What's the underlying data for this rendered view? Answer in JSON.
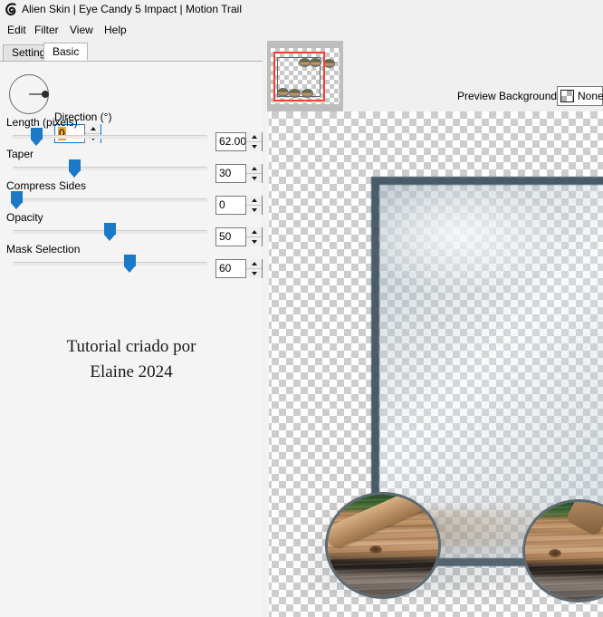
{
  "window": {
    "icon": "alien-skin-logo-icon",
    "title": "Alien Skin | Eye Candy 5 Impact | Motion Trail"
  },
  "menubar": {
    "items": [
      {
        "label": "Edit"
      },
      {
        "label": "Filter"
      },
      {
        "label": "View"
      },
      {
        "label": "Help"
      }
    ]
  },
  "tabs": [
    {
      "label": "Settings",
      "active": false
    },
    {
      "label": "Basic",
      "active": true
    }
  ],
  "controls": {
    "direction": {
      "label": "Direction (°)",
      "value": "0",
      "selected": true,
      "dial_angle_deg": 0
    },
    "sliders": [
      {
        "label": "Length (pixels)",
        "value": "62.00",
        "thumb_pct": 12
      },
      {
        "label": "Taper",
        "value": "30",
        "thumb_pct": 31
      },
      {
        "label": "Compress Sides",
        "value": "0",
        "thumb_pct": 2
      },
      {
        "label": "Opacity",
        "value": "50",
        "thumb_pct": 48
      },
      {
        "label": "Mask Selection",
        "value": "60",
        "thumb_pct": 59
      }
    ]
  },
  "watermark": {
    "line1": "Tutorial criado por",
    "line2": "Elaine 2024"
  },
  "preview": {
    "navigator": {
      "name": "navigator-thumbnail",
      "viewport_color": "#ff3b30"
    },
    "tools": [
      {
        "name": "eyedropper-tool",
        "selected": false
      },
      {
        "name": "hand-tool",
        "selected": false
      },
      {
        "name": "zoom-tool",
        "selected": false
      },
      {
        "name": "select-arrow-tool",
        "selected": true
      }
    ],
    "background": {
      "label": "Preview Background:",
      "value": "None",
      "swatch": "checkerboard-swatch-icon"
    }
  },
  "colors": {
    "accent": "#1b79c8",
    "selection_highlight": "#f0a33c",
    "viewport_rect": "#ff3b30",
    "frame_border": "#3c505e",
    "tool_selected_bg": "#cde4f7",
    "panel_bg": "#f0f0f0"
  }
}
